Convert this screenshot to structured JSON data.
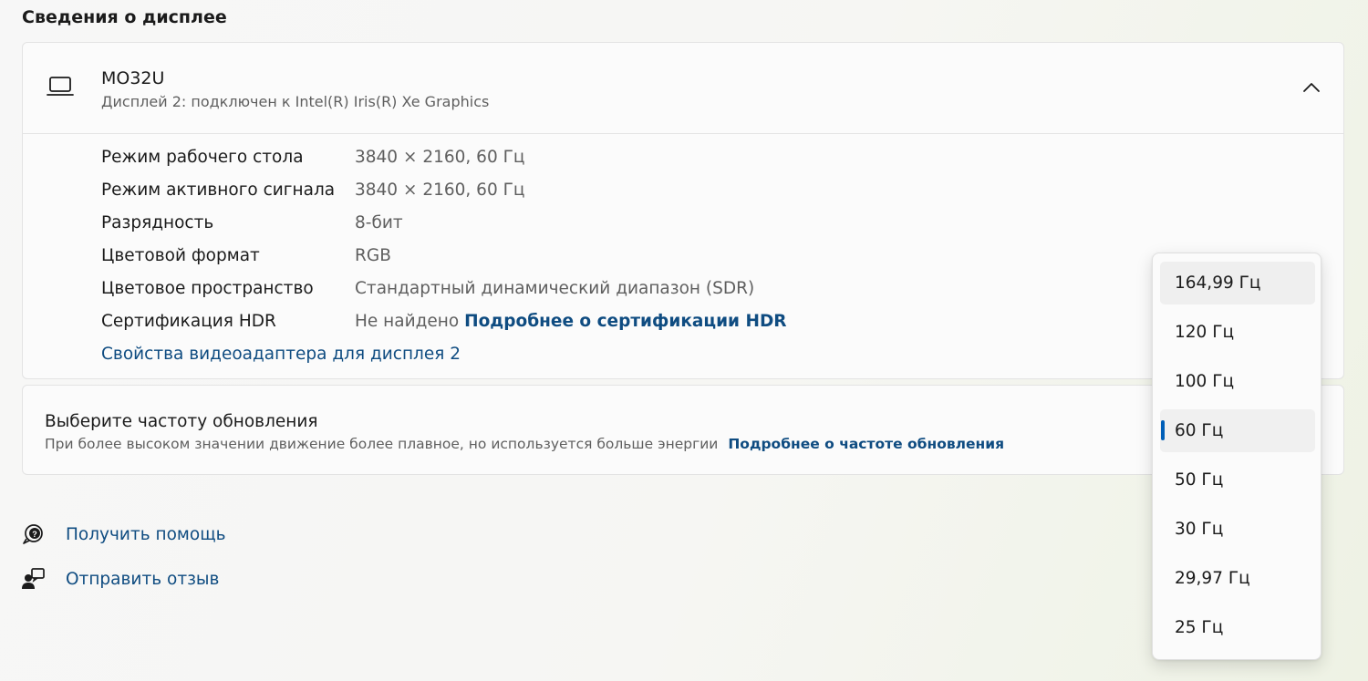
{
  "section_title": "Сведения о дисплее",
  "display": {
    "name": "MO32U",
    "subtitle": "Дисплей 2: подключен к Intel(R) Iris(R) Xe Graphics",
    "rows": [
      {
        "label": "Режим рабочего стола",
        "value": "3840 × 2160, 60 Гц"
      },
      {
        "label": "Режим активного сигнала",
        "value": "3840 × 2160, 60 Гц"
      },
      {
        "label": "Разрядность",
        "value": "8-бит"
      },
      {
        "label": "Цветовой формат",
        "value": "RGB"
      },
      {
        "label": "Цветовое пространство",
        "value": "Стандартный динамический диапазон (SDR)"
      },
      {
        "label": "Сертификация HDR",
        "value": "Не найдено",
        "link": "Подробнее о сертификации HDR"
      }
    ],
    "adapter_link": "Свойства видеоадаптера для дисплея 2"
  },
  "refresh": {
    "title": "Выберите частоту обновления",
    "description": "При более высоком значении движение более плавное, но используется больше энергии",
    "link": "Подробнее о частоте обновления"
  },
  "help": {
    "get_help": "Получить помощь",
    "feedback": "Отправить отзыв"
  },
  "dropdown": {
    "options": [
      "164,99 Гц",
      "120 Гц",
      "100 Гц",
      "60 Гц",
      "50 Гц",
      "30 Гц",
      "29,97 Гц",
      "25 Гц"
    ],
    "selected": "60 Гц",
    "hovered": "164,99 Гц"
  },
  "colors": {
    "accent": "#005fb8",
    "link": "#0f4c81"
  },
  "icons": [
    "laptop-icon",
    "chevron-up-icon",
    "help-icon",
    "feedback-icon"
  ]
}
